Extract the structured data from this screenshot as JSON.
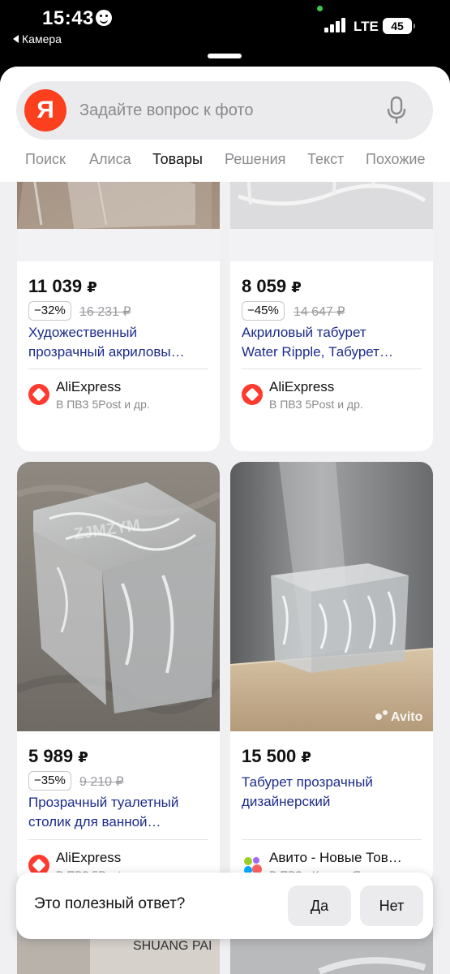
{
  "status_bar": {
    "time": "15:43",
    "back_label": "Камера",
    "network": "LTE",
    "battery": "45"
  },
  "search": {
    "logo": "Я",
    "placeholder": "Задайте вопрос к фото"
  },
  "tabs": [
    "Поиск",
    "Алиса",
    "Товары",
    "Решения",
    "Текст",
    "Похожие"
  ],
  "active_tab": "Товары",
  "products": [
    {
      "price": "11 039",
      "currency": "₽",
      "discount": "−32%",
      "old_price": "16 231",
      "title_line1": "Художественный",
      "title_line2": "прозрачный акриловы…",
      "shop": "AliExpress",
      "delivery": "В ПВЗ 5Post и др."
    },
    {
      "price": "8 059",
      "currency": "₽",
      "discount": "−45%",
      "old_price": "14 647",
      "title_line1": "Акриловый табурет",
      "title_line2": "Water Ripple, Табурет…",
      "shop": "AliExpress",
      "delivery": "В ПВЗ 5Post и др."
    },
    {
      "price": "5 989",
      "currency": "₽",
      "discount": "−35%",
      "old_price": "9 210",
      "title_line1": "Прозрачный туалетный",
      "title_line2": "столик для ванной…",
      "shop": "AliExpress",
      "delivery": "В ПВЗ 5Post и др.",
      "image_watermark": "ZJMZYM"
    },
    {
      "price": "15 500",
      "currency": "₽",
      "title_line1": "Табурет прозрачный",
      "title_line2": "дизайнерский",
      "shop": "Авито - Новые Тов…",
      "delivery": "В ПВЗ · Курьер Яндекса",
      "image_watermark": "Avito"
    }
  ],
  "partial_image_text": "SHUANG PAI",
  "feedback": {
    "question": "Это полезный ответ?",
    "yes": "Да",
    "no": "Нет"
  },
  "colors": {
    "accent_red": "#fc3f1d",
    "link_blue": "#1c2b8a",
    "aliexpress_red": "#ff3b30"
  }
}
